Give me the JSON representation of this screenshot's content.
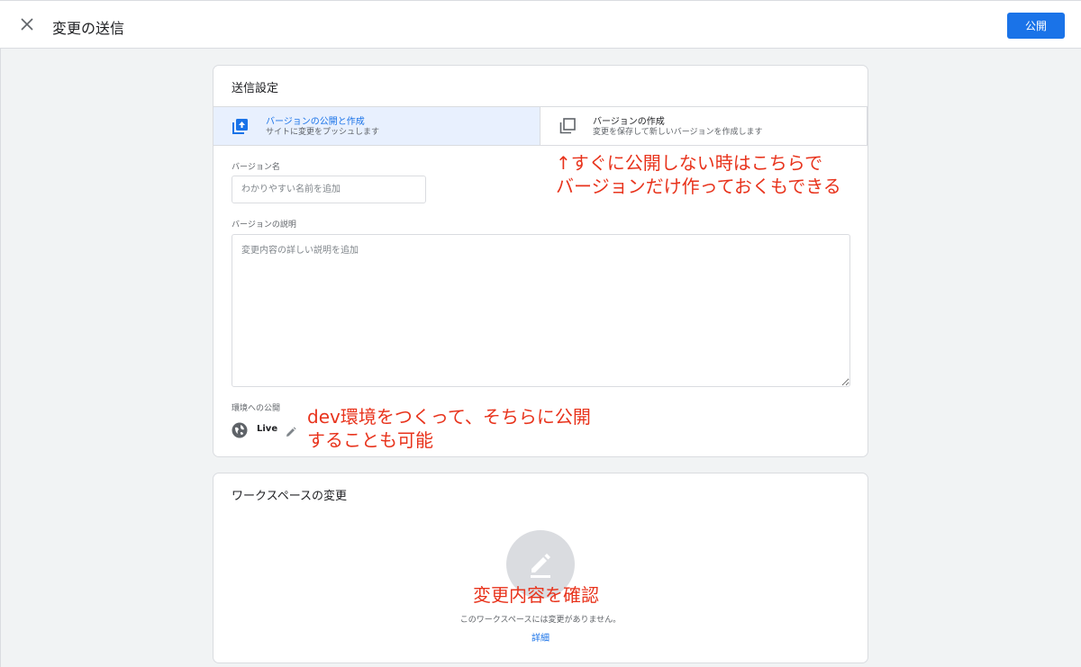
{
  "header": {
    "title": "変更の送信",
    "publish_label": "公開"
  },
  "submission": {
    "section_title": "送信設定",
    "options": [
      {
        "title": "バージョンの公開と作成",
        "subtitle": "サイトに変更をプッシュします",
        "selected": true
      },
      {
        "title": "バージョンの作成",
        "subtitle": "変更を保存して新しいバージョンを作成します",
        "selected": false
      }
    ],
    "version_name": {
      "label": "バージョン名",
      "placeholder": "わかりやすい名前を追加",
      "value": ""
    },
    "version_description": {
      "label": "バージョンの説明",
      "placeholder": "変更内容の詳しい説明を追加",
      "value": ""
    },
    "environment": {
      "label": "環境への公開",
      "name": "Live"
    }
  },
  "workspace_changes": {
    "section_title": "ワークスペースの変更",
    "empty_message": "このワークスペースには変更がありません。",
    "details_link": "詳細"
  },
  "annotations": {
    "note1_line1": "↑すぐに公開しない時はこちらで",
    "note1_line2": "バージョンだけ作っておくもできる",
    "note2_line1": "dev環境をつくって、そちらに公開",
    "note2_line2": "することも可能",
    "note3": "変更内容を確認"
  },
  "colors": {
    "accent": "#1a73e8",
    "selected_bg": "#e8f0fe",
    "annotation": "#e8331c"
  },
  "icons": {
    "close": "close-icon",
    "publish_version": "publish-upload-icon",
    "create_version": "copy-icon",
    "environment": "globe-icon",
    "edit": "pencil-icon",
    "empty_state": "edit-pencil-icon"
  }
}
